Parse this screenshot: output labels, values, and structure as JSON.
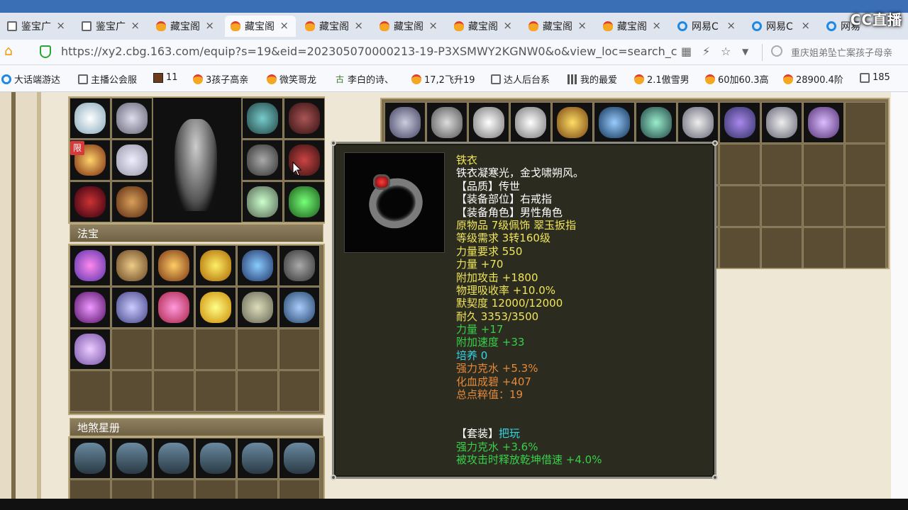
{
  "tabs": [
    {
      "label": "鉴宝广",
      "icon": "doc-icon",
      "active": false
    },
    {
      "label": "鉴宝广",
      "icon": "doc-icon",
      "active": false
    },
    {
      "label": "藏宝阁",
      "icon": "chick-icon",
      "active": false
    },
    {
      "label": "藏宝阁",
      "icon": "chick-icon",
      "active": true
    },
    {
      "label": "藏宝阁",
      "icon": "chick-icon",
      "active": false
    },
    {
      "label": "藏宝阁",
      "icon": "chick-icon",
      "active": false
    },
    {
      "label": "藏宝阁",
      "icon": "chick-icon",
      "active": false
    },
    {
      "label": "藏宝阁",
      "icon": "chick-icon",
      "active": false
    },
    {
      "label": "藏宝阁",
      "icon": "chick-icon",
      "active": false
    },
    {
      "label": "网易C",
      "icon": "ie-icon",
      "active": false
    },
    {
      "label": "网易C",
      "icon": "ie-icon",
      "active": false
    },
    {
      "label": "网易",
      "icon": "ie-icon",
      "active": false
    }
  ],
  "tab_close_glyph": "×",
  "watermark": "CC直播",
  "address": {
    "url": "https://xy2.cbg.163.com/equip?s=19&eid=202305070000213-19-P3XSMWY2KGNW0&o&view_loc=search_cond|",
    "search_text": "重庆姐弟坠亡案孩子母亲",
    "tool_icons": [
      "grid-icon",
      "bolt-icon",
      "star-icon",
      "chevron-down-icon"
    ]
  },
  "bookmarks": [
    {
      "label": "大话端游达",
      "icon": "ie"
    },
    {
      "label": "主播公会服",
      "icon": "doc"
    },
    {
      "label": "11",
      "icon": "game"
    },
    {
      "label": "3孩子高亲",
      "icon": "chick"
    },
    {
      "label": "微笑哥龙",
      "icon": "chick"
    },
    {
      "label": "李白的诗、",
      "icon": "poem"
    },
    {
      "label": "17,2飞升19",
      "icon": "chick"
    },
    {
      "label": "达人后台系",
      "icon": "doc"
    },
    {
      "label": "我的最爱",
      "icon": "grid"
    },
    {
      "label": "2.1傲雪男",
      "icon": "chick"
    },
    {
      "label": "60加60.3高",
      "icon": "chick"
    },
    {
      "label": "28900.4阶",
      "icon": "chick"
    },
    {
      "label": "185",
      "icon": "doc"
    }
  ],
  "limit_badge": "限",
  "sections": {
    "fabao": "法宝",
    "disha": "地煞星册"
  },
  "tooltip": {
    "lines": [
      {
        "text": "铁衣",
        "color": "#f0e65a"
      },
      {
        "text": "铁衣凝寒光，金戈啸朔风。",
        "color": "#ffffff"
      },
      {
        "text": "【品质】传世",
        "color": "#ffffff"
      },
      {
        "text": "【装备部位】右戒指",
        "color": "#ffffff"
      },
      {
        "text": "【装备角色】男性角色",
        "color": "#ffffff"
      },
      {
        "text": "原物品 7级佩饰 翠玉扳指",
        "color": "#f0e65a"
      },
      {
        "text": "等级需求 3转160级",
        "color": "#f0e65a"
      },
      {
        "text": "力量要求 550",
        "color": "#f0e65a"
      },
      {
        "text": "力量 +70",
        "color": "#f0e65a"
      },
      {
        "text": "附加攻击 +1800",
        "color": "#f0e65a"
      },
      {
        "text": "物理吸收率 +10.0%",
        "color": "#f0e65a"
      },
      {
        "text": "默契度 12000/12000",
        "color": "#f0e65a"
      },
      {
        "text": "耐久 3353/3500",
        "color": "#f0e65a"
      },
      {
        "text": "力量 +17",
        "color": "#38d14a"
      },
      {
        "text": "附加速度 +33",
        "color": "#38d14a"
      },
      {
        "text": "培养 0",
        "color": "#33d5e6"
      },
      {
        "text": "强力克水 +5.3%",
        "color": "#e58a3a"
      },
      {
        "text": "化血成碧 +407",
        "color": "#e58a3a"
      },
      {
        "text": "总点粹值：19",
        "color": "#e58a3a"
      },
      {
        "text": "",
        "color": "#ffffff"
      },
      {
        "text": "",
        "color": "#ffffff"
      },
      {
        "text": "【套装】",
        "color": "#ffffff",
        "suffix": "把玩",
        "suffix_color": "#33d5e6"
      },
      {
        "text": "强力克水 +3.6%",
        "color": "#38d14a"
      },
      {
        "text": "被攻击时释放乾坤借速 +4.0%",
        "color": "#38d14a"
      }
    ]
  }
}
